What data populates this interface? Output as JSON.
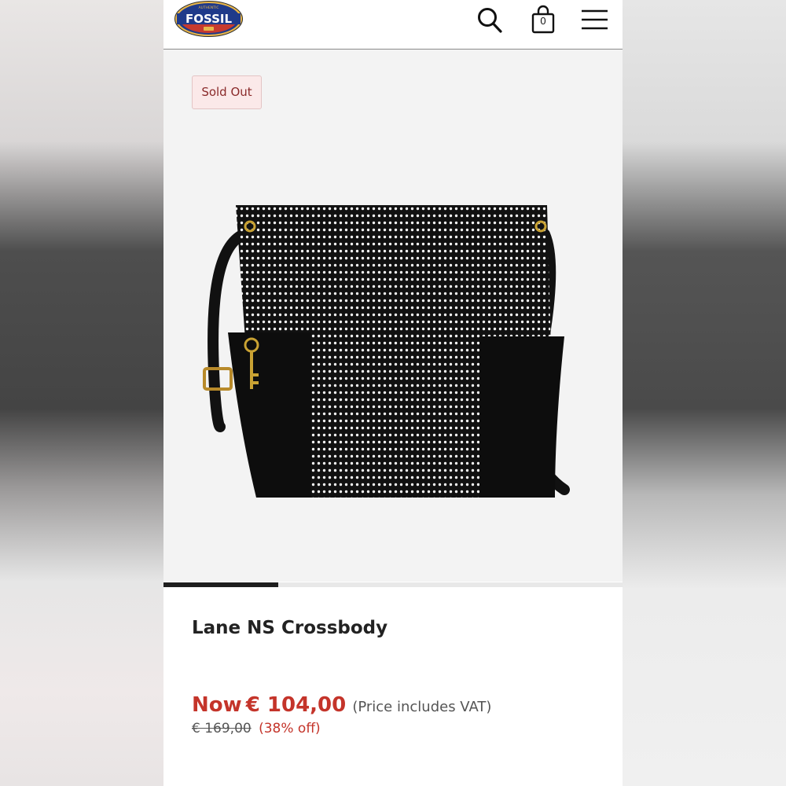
{
  "header": {
    "logo": {
      "brand": "FOSSIL",
      "tagline": "AUTHENTIC"
    },
    "search_icon": "search-icon",
    "bag_icon": "shopping-bag-icon",
    "bag_count": "0",
    "menu_icon": "hamburger-menu-icon"
  },
  "gallery": {
    "badge": "Sold Out",
    "image_slide_progress": 0.25
  },
  "product": {
    "title": "Lane NS Crossbody",
    "price_now_label": "Now",
    "price_now_value": "€ 104,00",
    "vat_note": "(Price includes VAT)",
    "was_price": "€ 169,00",
    "discount": "(38% off)"
  },
  "colors": {
    "accent_red": "#c4342a",
    "badge_bg": "#fbe9e9",
    "logo_navy": "#1f3a8a",
    "logo_gold": "#e8b64a"
  }
}
